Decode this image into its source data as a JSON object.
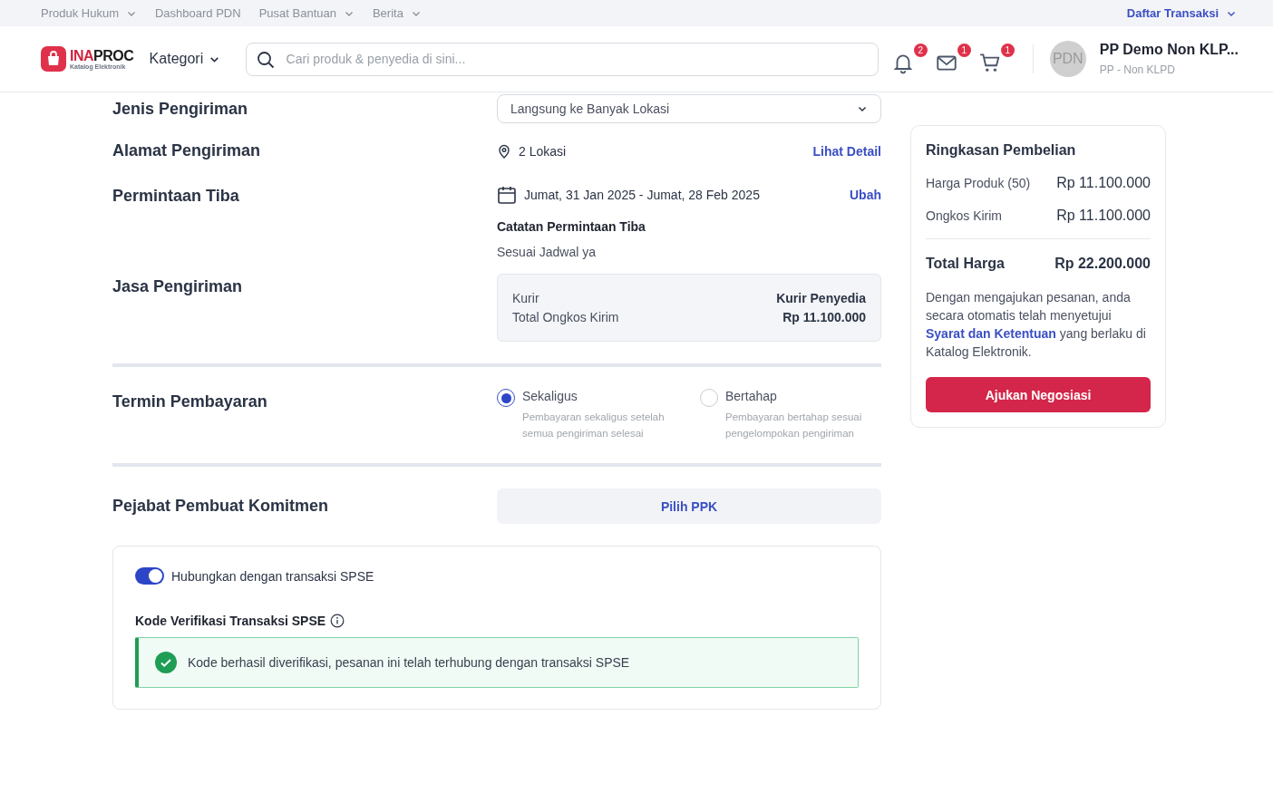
{
  "top_nav": {
    "items": [
      {
        "label": "Produk Hukum",
        "dropdown": true
      },
      {
        "label": "Dashboard PDN",
        "dropdown": false
      },
      {
        "label": "Pusat Bantuan",
        "dropdown": true
      },
      {
        "label": "Berita",
        "dropdown": true
      }
    ],
    "right_link": {
      "label": "Daftar Transaksi",
      "dropdown": true
    }
  },
  "header": {
    "logo": {
      "wordmark_red": "INA",
      "wordmark_dark": "PROC",
      "subtitle": "Katalog Elektronik"
    },
    "category": "Kategori",
    "search": {
      "placeholder": "Cari produk & penyedia di sini..."
    },
    "icons": [
      {
        "kind": "bell",
        "badge": "2"
      },
      {
        "kind": "mail",
        "badge": "1"
      },
      {
        "kind": "cart",
        "badge": "1"
      }
    ],
    "user": {
      "avatar": "PDN",
      "name": "PP Demo Non KLP...",
      "role": "PP - Non KLPD"
    }
  },
  "shipping_type": {
    "label": "Jenis Pengiriman",
    "value": "Langsung ke Banyak Lokasi"
  },
  "address": {
    "label": "Alamat Pengiriman",
    "value": "2 Lokasi",
    "link": "Lihat Detail"
  },
  "arrival": {
    "label": "Permintaan Tiba",
    "date_range": "Jumat, 31 Jan 2025 - Jumat, 28 Feb 2025",
    "link": "Ubah",
    "note_label": "Catatan Permintaan Tiba",
    "note": "Sesuai Jadwal ya"
  },
  "courier": {
    "label": "Jasa Pengiriman",
    "rows": [
      {
        "label": "Kurir",
        "value": "Kurir Penyedia"
      },
      {
        "label": "Total Ongkos Kirim",
        "value": "Rp 11.100.000"
      }
    ]
  },
  "payment_term": {
    "label": "Termin Pembayaran",
    "options": [
      {
        "label": "Sekaligus",
        "description": "Pembayaran sekaligus setelah semua pengiriman selesai",
        "selected": true
      },
      {
        "label": "Bertahap",
        "description": "Pembayaran bertahap sesuai pengelompokan pengiriman",
        "selected": false
      }
    ]
  },
  "ppk": {
    "label": "Pejabat Pembuat Komitmen",
    "button": "Pilih PPK"
  },
  "spse": {
    "toggle": {
      "label": "Hubungkan dengan transaksi SPSE",
      "on": true
    },
    "code_label": "Kode Verifikasi Transaksi SPSE",
    "message": "Kode berhasil diverifikasi, pesanan ini telah terhubung dengan transaksi SPSE",
    "verified": true
  },
  "summary": {
    "title": "Ringkasan Pembelian",
    "lines": [
      {
        "label": "Harga Produk (50)",
        "value": "Rp 11.100.000"
      },
      {
        "label": "Ongkos Kirim",
        "value": "Rp 11.100.000"
      }
    ],
    "total": {
      "label": "Total Harga",
      "value": "Rp 22.200.000"
    },
    "disclaimer_before": "Dengan mengajukan pesanan, anda secara otomatis telah menyetujui",
    "disclaimer_link": "Syarat dan Ketentuan",
    "disclaimer_after": "yang berlaku di Katalog Elektronik.",
    "button": "Ajukan Negosiasi"
  }
}
